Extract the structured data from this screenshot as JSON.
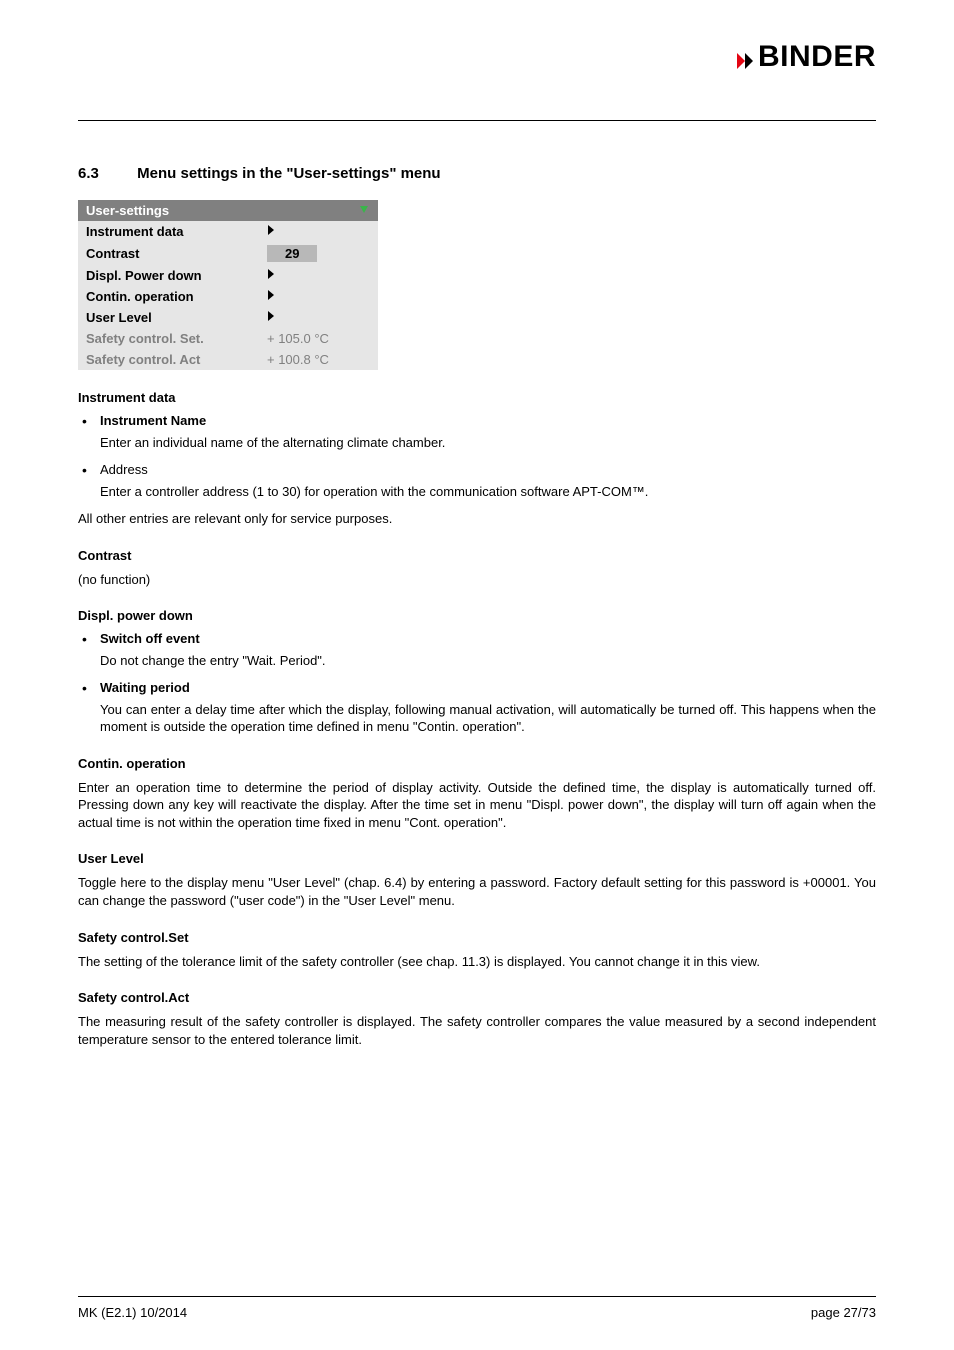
{
  "logo_text": "BINDER",
  "section_number": "6.3",
  "section_title": "Menu settings in the \"User-settings\" menu",
  "menu": {
    "title": "User-settings",
    "rows": [
      {
        "label": "Instrument data",
        "value_type": "arrow",
        "bold": true
      },
      {
        "label": "Contrast",
        "value_type": "contrast",
        "value": "29",
        "bold": true
      },
      {
        "label": "Displ. Power down",
        "value_type": "arrow",
        "bold": true
      },
      {
        "label": "Contin. operation",
        "value_type": "arrow",
        "bold": true
      },
      {
        "label": "User Level",
        "value_type": "arrow",
        "bold": true
      },
      {
        "label": "Safety control. Set.",
        "value_type": "dim",
        "value": "+  105.0  °C",
        "bold": false
      },
      {
        "label": "Safety control. Act",
        "value_type": "dim",
        "value": "+  100.8  °C",
        "bold": false
      }
    ]
  },
  "instrument_data": {
    "heading": "Instrument data",
    "b1_label": "Instrument Name",
    "b1_text": "Enter an individual name of the alternating climate chamber.",
    "b2_label": "Address",
    "b2_text": "Enter a controller address (1 to 30) for operation with the communication software APT-COM™.",
    "tail": "All other entries are relevant only for service purposes."
  },
  "contrast": {
    "heading": "Contrast",
    "text": "(no function)"
  },
  "displ_pd": {
    "heading": "Displ. power down",
    "b1_label": "Switch off event",
    "b1_text": "Do not change the entry \"Wait. Period\".",
    "b2_label": "Waiting period",
    "b2_text": "You can enter a delay time after which the display, following manual activation, will automatically be turned off. This happens when the moment is outside the operation time defined in menu \"Contin. operation\"."
  },
  "contin_op": {
    "heading": "Contin. operation",
    "text": "Enter an operation time to determine the period of display activity. Outside the defined time, the display is automatically turned off. Pressing down any key will reactivate the display. After the time set in menu \"Displ. power down\", the display will turn off again when the actual time is not within the operation time fixed in menu \"Cont. operation\"."
  },
  "user_level": {
    "heading": "User Level",
    "text": "Toggle here to the display menu \"User Level\" (chap. 6.4) by entering a password. Factory default setting for this password is +00001. You can change the password (\"user code\") in the \"User Level\" menu."
  },
  "sc_set": {
    "heading": "Safety control.Set",
    "text": "The setting of the tolerance limit of the safety controller (see chap. 11.3) is displayed. You cannot change it in this view."
  },
  "sc_act": {
    "heading": "Safety control.Act",
    "text": "The measuring result of the safety controller is displayed. The safety controller compares the value measured by a second independent temperature sensor to the entered tolerance limit."
  },
  "footer": {
    "left": "MK (E2.1) 10/2014",
    "right": "page 27/73"
  }
}
